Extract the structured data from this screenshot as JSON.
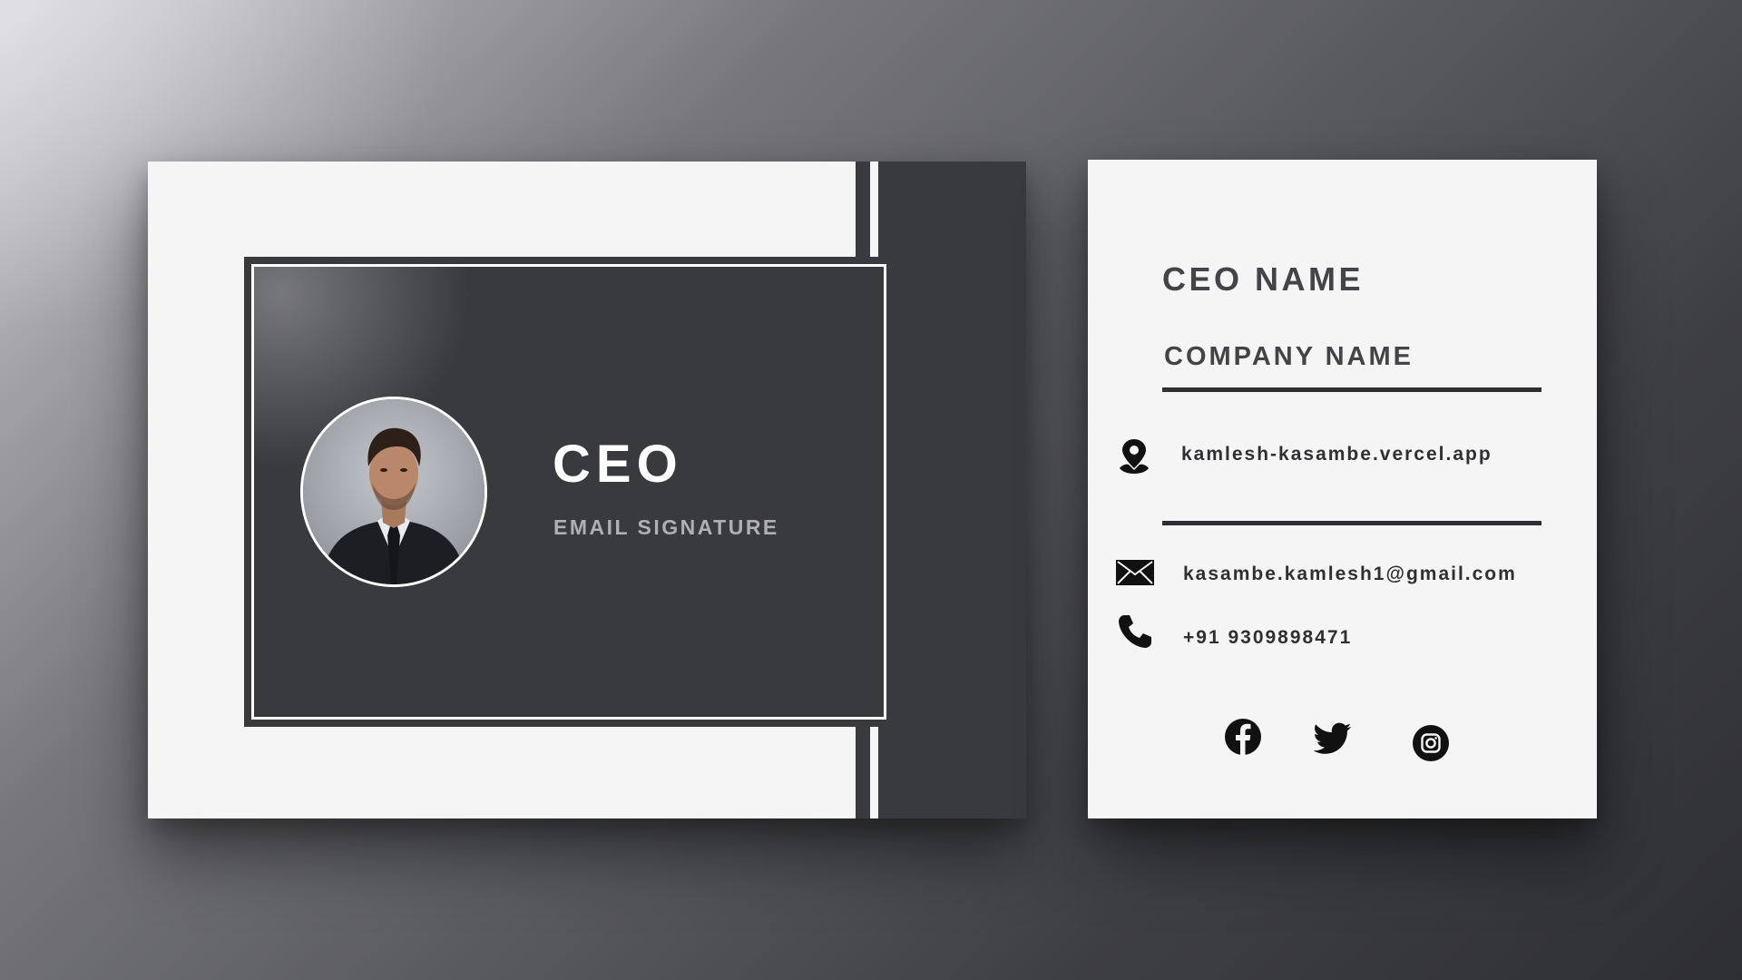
{
  "front": {
    "title": "CEO",
    "subtitle": "EMAIL SIGNATURE"
  },
  "back": {
    "ceo_name": "CEO NAME",
    "company_name": "COMPANY NAME",
    "contacts": {
      "website": "kamlesh-kasambe.vercel.app",
      "email": "kasambe.kamlesh1@gmail.com",
      "phone": "+91 9309898471"
    },
    "icons": {
      "website": "location-pin-icon",
      "email": "envelope-icon",
      "phone": "phone-icon"
    },
    "social": [
      "facebook-icon",
      "twitter-icon",
      "instagram-icon"
    ]
  },
  "colors": {
    "card_dark": "#393a3e",
    "card_light": "#f5f5f5",
    "text_dark": "#444448",
    "subtitle_gray": "#b0b0b4"
  }
}
